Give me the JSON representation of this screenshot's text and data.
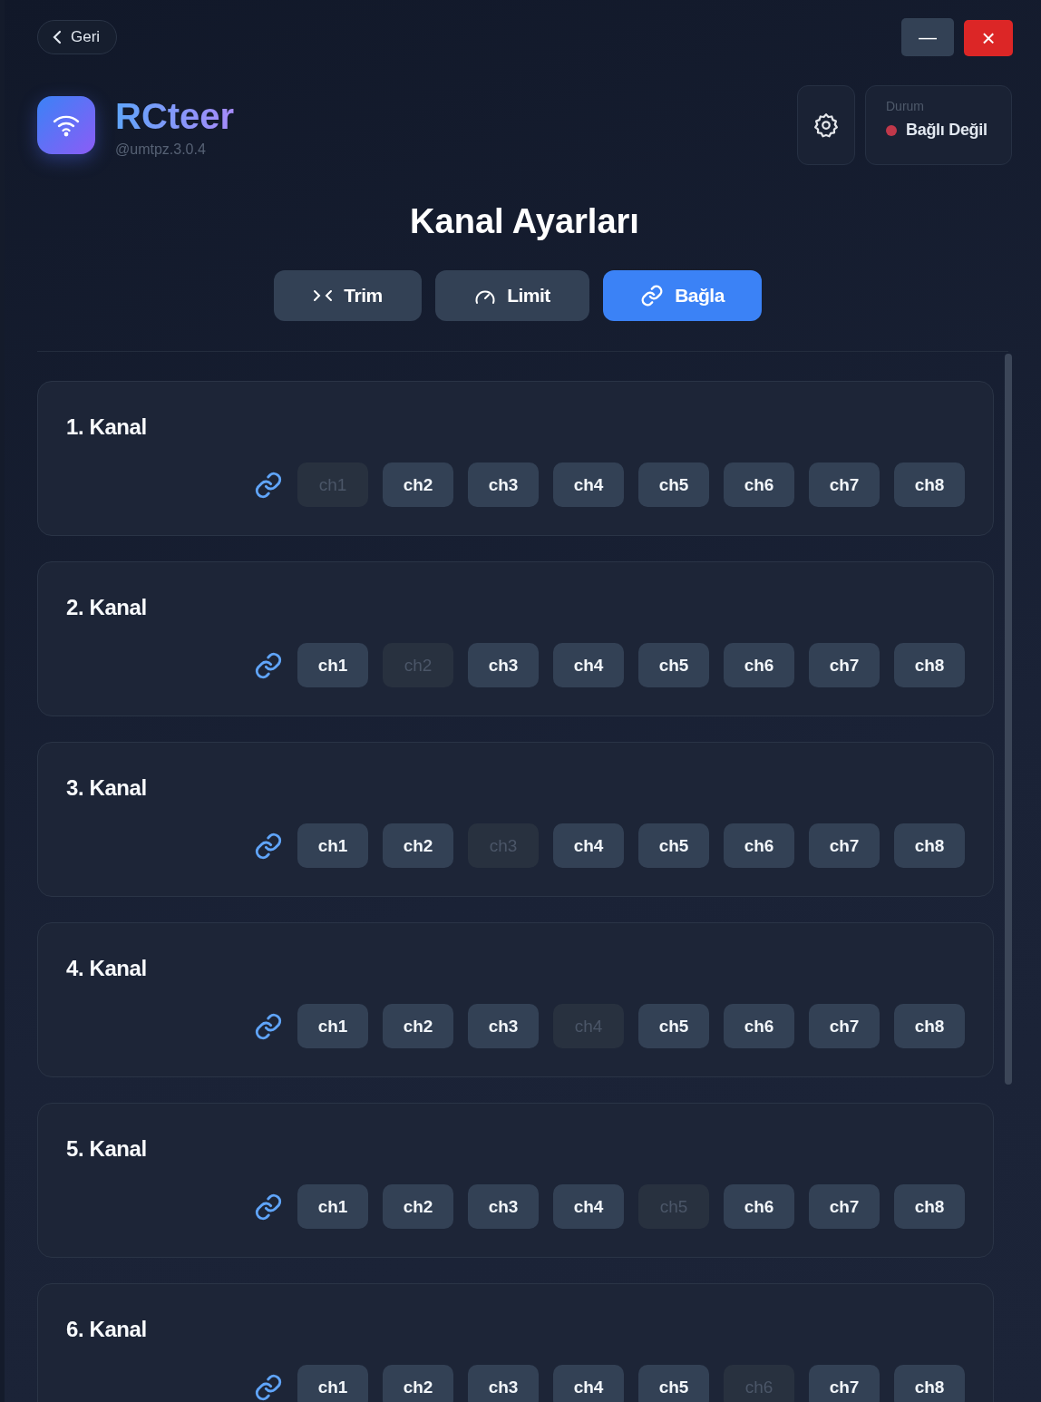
{
  "back_button": {
    "label": "Geri"
  },
  "window_controls": {
    "minimize": "—",
    "close": "×"
  },
  "app": {
    "name": "RCteer",
    "version": "@umtpz.3.0.4"
  },
  "status": {
    "label": "Durum",
    "value": "Bağlı Değil",
    "color": "#c0384a"
  },
  "heading": "Kanal Ayarları",
  "tabs": [
    {
      "kind": "trim",
      "label": "Trim",
      "selected": false
    },
    {
      "kind": "limit",
      "label": "Limit",
      "selected": false
    },
    {
      "kind": "link",
      "label": "Bağla",
      "selected": true
    }
  ],
  "channels": [
    {
      "title": "1. Kanal",
      "chips": [
        {
          "label": "ch1",
          "disabled": true
        },
        {
          "label": "ch2",
          "disabled": false
        },
        {
          "label": "ch3",
          "disabled": false
        },
        {
          "label": "ch4",
          "disabled": false
        },
        {
          "label": "ch5",
          "disabled": false
        },
        {
          "label": "ch6",
          "disabled": false
        },
        {
          "label": "ch7",
          "disabled": false
        },
        {
          "label": "ch8",
          "disabled": false
        }
      ]
    },
    {
      "title": "2. Kanal",
      "chips": [
        {
          "label": "ch1",
          "disabled": false
        },
        {
          "label": "ch2",
          "disabled": true
        },
        {
          "label": "ch3",
          "disabled": false
        },
        {
          "label": "ch4",
          "disabled": false
        },
        {
          "label": "ch5",
          "disabled": false
        },
        {
          "label": "ch6",
          "disabled": false
        },
        {
          "label": "ch7",
          "disabled": false
        },
        {
          "label": "ch8",
          "disabled": false
        }
      ]
    },
    {
      "title": "3. Kanal",
      "chips": [
        {
          "label": "ch1",
          "disabled": false
        },
        {
          "label": "ch2",
          "disabled": false
        },
        {
          "label": "ch3",
          "disabled": true
        },
        {
          "label": "ch4",
          "disabled": false
        },
        {
          "label": "ch5",
          "disabled": false
        },
        {
          "label": "ch6",
          "disabled": false
        },
        {
          "label": "ch7",
          "disabled": false
        },
        {
          "label": "ch8",
          "disabled": false
        }
      ]
    },
    {
      "title": "4. Kanal",
      "chips": [
        {
          "label": "ch1",
          "disabled": false
        },
        {
          "label": "ch2",
          "disabled": false
        },
        {
          "label": "ch3",
          "disabled": false
        },
        {
          "label": "ch4",
          "disabled": true
        },
        {
          "label": "ch5",
          "disabled": false
        },
        {
          "label": "ch6",
          "disabled": false
        },
        {
          "label": "ch7",
          "disabled": false
        },
        {
          "label": "ch8",
          "disabled": false
        }
      ]
    },
    {
      "title": "5. Kanal",
      "chips": [
        {
          "label": "ch1",
          "disabled": false
        },
        {
          "label": "ch2",
          "disabled": false
        },
        {
          "label": "ch3",
          "disabled": false
        },
        {
          "label": "ch4",
          "disabled": false
        },
        {
          "label": "ch5",
          "disabled": true
        },
        {
          "label": "ch6",
          "disabled": false
        },
        {
          "label": "ch7",
          "disabled": false
        },
        {
          "label": "ch8",
          "disabled": false
        }
      ]
    },
    {
      "title": "6. Kanal",
      "chips": [
        {
          "label": "ch1",
          "disabled": false
        },
        {
          "label": "ch2",
          "disabled": false
        },
        {
          "label": "ch3",
          "disabled": false
        },
        {
          "label": "ch4",
          "disabled": false
        },
        {
          "label": "ch5",
          "disabled": false
        },
        {
          "label": "ch6",
          "disabled": true
        },
        {
          "label": "ch7",
          "disabled": false
        },
        {
          "label": "ch8",
          "disabled": false
        }
      ]
    }
  ]
}
